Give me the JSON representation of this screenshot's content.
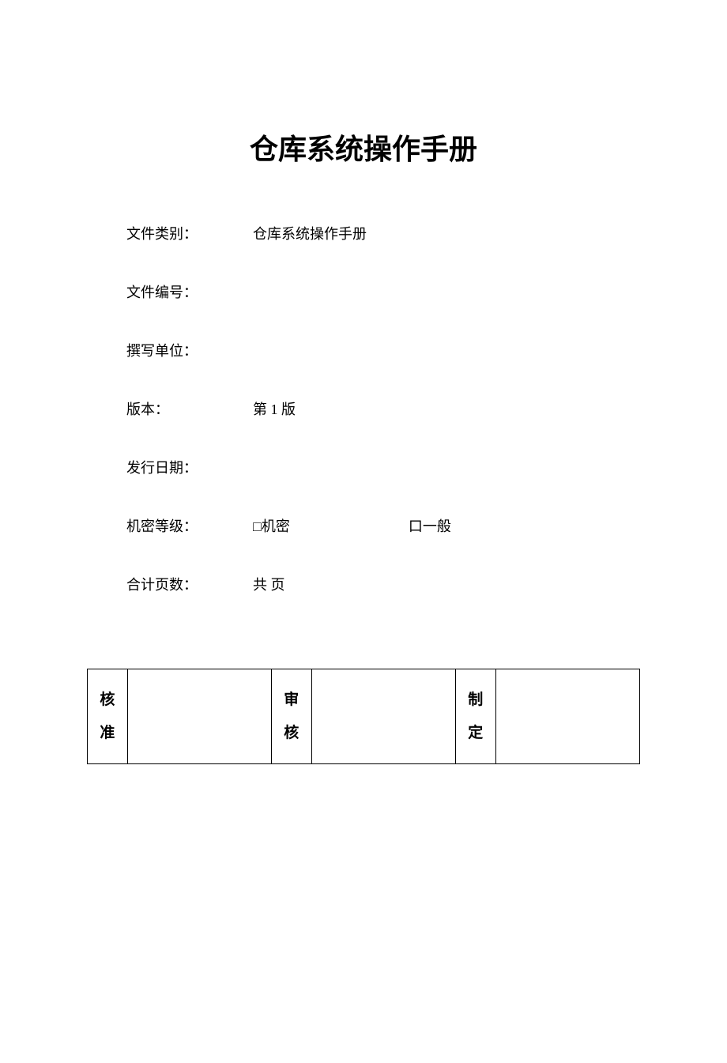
{
  "title": "仓库系统操作手册",
  "fields": {
    "category": {
      "label": "文件类别：",
      "value": "仓库系统操作手册"
    },
    "number": {
      "label": "文件编号：",
      "value": ""
    },
    "unit": {
      "label": "撰写单位：",
      "value": ""
    },
    "version": {
      "label": "版本：",
      "value": "第 1 版"
    },
    "publish_date": {
      "label": "发行日期：",
      "value": ""
    },
    "security": {
      "label": "机密等级：",
      "option1": "□机密",
      "option2": "口一般"
    },
    "pages": {
      "label": "合计页数：",
      "value": "共 页"
    }
  },
  "approval": {
    "col1": {
      "char1": "核",
      "char2": "准"
    },
    "col2": {
      "char1": "审",
      "char2": "核"
    },
    "col3": {
      "char1": "制",
      "char2": "定"
    }
  }
}
